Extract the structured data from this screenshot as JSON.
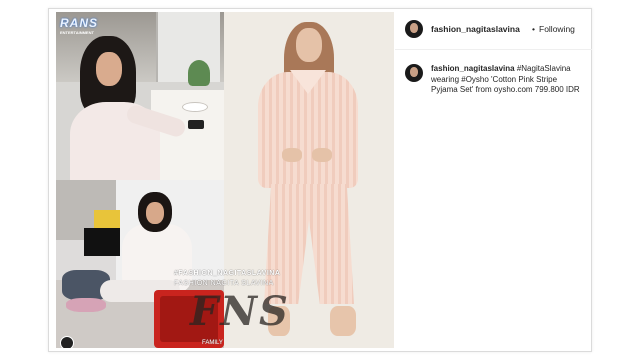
{
  "post": {
    "username": "fashion_nagitaslavina",
    "separator": "•",
    "follow_status": "Following",
    "caption": {
      "username": "fashion_nagitaslavina",
      "text": " #NagitaSlavina wearing #Oysho 'Cotton Pink Stripe Pyjama Set' from oysho.com 799.800 IDR"
    }
  },
  "media": {
    "logo": {
      "line1": "RANS",
      "line2": "ENTERTAINMENT"
    },
    "watermark": {
      "line1": "#FASHION_NAGITASLAVINA",
      "line2": "FASHION NAGITA SLAVINA",
      "big": "FNS",
      "line3": "FAMILY"
    }
  },
  "colors": {
    "text": "#262626",
    "border": "#dbdbdb",
    "pajama_pink": "#f0ccbd",
    "suitcase_red": "#c9241e"
  }
}
